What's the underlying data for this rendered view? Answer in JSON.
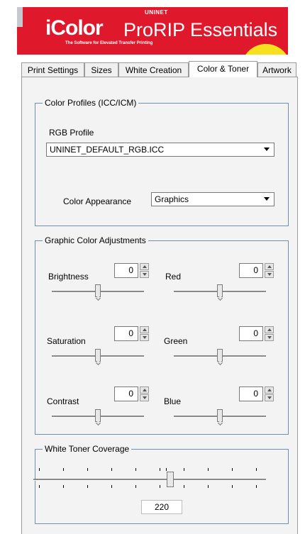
{
  "banner": {
    "top_text": "UNINET",
    "logo_text": "iColor",
    "product_name": "ProRIP Essentials",
    "tagline": "The Software for Elevated Transfer Printing"
  },
  "tabs": [
    {
      "label": "Print Settings",
      "active": false
    },
    {
      "label": "Sizes",
      "active": false
    },
    {
      "label": "White Creation",
      "active": false
    },
    {
      "label": "Color & Toner",
      "active": true
    },
    {
      "label": "Artwork",
      "active": false
    }
  ],
  "color_profiles": {
    "title": "Color Profiles (ICC/ICM)",
    "rgb_label": "RGB Profile",
    "rgb_value": "UNINET_DEFAULT_RGB.ICC",
    "appearance_label": "Color Appearance",
    "appearance_value": "Graphics"
  },
  "adjustments": {
    "title": "Graphic Color Adjustments",
    "brightness": {
      "label": "Brightness",
      "value": "0"
    },
    "red": {
      "label": "Red",
      "value": "0"
    },
    "saturation": {
      "label": "Saturation",
      "value": "0"
    },
    "green": {
      "label": "Green",
      "value": "0"
    },
    "contrast": {
      "label": "Contrast",
      "value": "0"
    },
    "blue": {
      "label": "Blue",
      "value": "0"
    }
  },
  "white_toner": {
    "title": "White Toner Coverage",
    "value": "220"
  },
  "colors": {
    "banner": "#e0182c",
    "banner_accent": "#f7e11f",
    "group_border": "#6e8fb0"
  }
}
